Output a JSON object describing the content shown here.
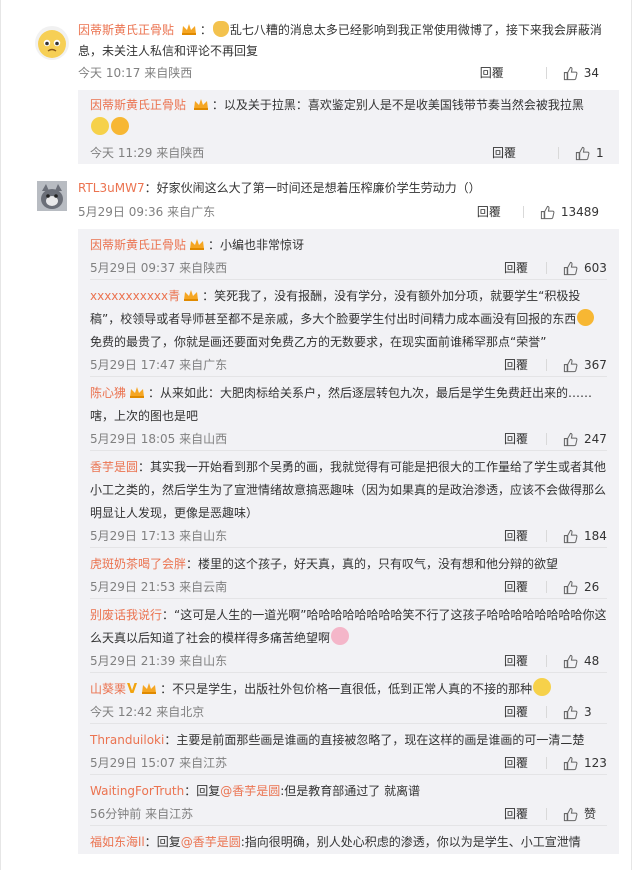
{
  "comments": [
    {
      "author": "因蒂斯黄氏正骨贴",
      "text": "乱七八糟的消息太多已经影响到我正常使用微博了，接下来我会屏蔽消息，未关注人私信和评论不再回复",
      "time": "今天 10:17 来自陕西",
      "reply_label": "回覆",
      "likes": "34",
      "replies": [
        {
          "author": "因蒂斯黄氏正骨贴",
          "text": "以及关于拉黑：喜欢鉴定别人是不是收美国钱带节奏当然会被我拉黑",
          "time": "今天 11:29 来自陕西",
          "reply_label": "回覆",
          "likes": "1"
        }
      ]
    },
    {
      "author": "RTL3uMW7",
      "text": "好家伙闹这么大了第一时间还是想着压榨廉价学生劳动力（）",
      "time": "5月29日 09:36 来自广东",
      "reply_label": "回覆",
      "likes": "13489",
      "replies": [
        {
          "author": "因蒂斯黄氏正骨贴",
          "text": "小编也非常惊讶",
          "time": "5月29日 09:37 来自陕西",
          "reply_label": "回覆",
          "likes": "603"
        },
        {
          "author": "xxxxxxxxxxx青",
          "text_a": "笑死我了，没有报酬，没有学分，没有额外加分项，就要学生“积极投稿”，校领导或者导师甚至都不是亲戚，多大个脸要学生付出时间精力成本画没有回报的东西",
          "text_b": "免费的最贵了，你就是画还要面对免费乙方的无数要求，在现实面前谁稀罕那点“荣誉”",
          "time": "5月29日 17:47 来自广东",
          "reply_label": "回覆",
          "likes": "367"
        },
        {
          "author": "陈心狒",
          "text": "从来如此：大肥肉标给关系户，然后逐层转包九次，最后是学生免费赶出来的……嗐，上次的图也是吧",
          "time": "5月29日 18:05 来自山西",
          "reply_label": "回覆",
          "likes": "247"
        },
        {
          "author": "香芋是圆",
          "text": "其实我一开始看到那个吴勇的画，我就觉得有可能是把很大的工作量给了学生或者其他小工之类的，然后学生为了宣泄情绪故意搞恶趣味（因为如果真的是政治渗透，应该不会做得那么明显让人发现，更像是恶趣味）",
          "time": "5月29日 17:13 来自山东",
          "reply_label": "回覆",
          "likes": "184"
        },
        {
          "author": "虎斑奶茶喝了会胖",
          "text": "楼里的这个孩子，好天真，真的，只有叹气，没有想和他分辩的欲望",
          "time": "5月29日 21:53 来自云南",
          "reply_label": "回覆",
          "likes": "26"
        },
        {
          "author": "别废话我说行",
          "text": "“这可是人生的一道光啊”哈哈哈哈哈哈哈哈笑不行了这孩子哈哈哈哈哈哈哈哈你这么天真以后知道了社会的模样得多痛苦绝望啊",
          "time": "5月29日 21:39 来自山东",
          "reply_label": "回覆",
          "likes": "48"
        },
        {
          "author": "山葵栗",
          "text": "不只是学生，出版社外包价格一直很低，低到正常人真的不接的那种",
          "time": "今天 12:42 来自北京",
          "reply_label": "回覆",
          "likes": "3"
        },
        {
          "author": "Thranduiloki",
          "text": "主要是前面那些画是谁画的直接被忽略了，现在这样的画是谁画的可一清二楚",
          "time": "5月29日 15:07 来自江苏",
          "reply_label": "回覆",
          "likes": "123"
        },
        {
          "author": "WaitingForTruth",
          "prefix": "回复",
          "mention": "@香芋是圆",
          "text": ":但是教育部通过了 就离谱",
          "time": "56分钟前 来自江苏",
          "reply_label": "回覆",
          "likes": "赞"
        },
        {
          "author": "福如东海ll",
          "prefix": "回复",
          "mention": "@香芋是圆",
          "text": ":指向很明确，别人处心积虑的渗透，你以为是学生、小工宣泄情"
        }
      ]
    }
  ],
  "icons": {
    "like": "thumbs-up-icon",
    "vip": "crown-badge-icon",
    "verified": "v-badge-icon"
  },
  "colors": {
    "username": "#eb7350",
    "meta": "#808080",
    "reply_bg": "#f2f2f5",
    "text": "#333333"
  }
}
